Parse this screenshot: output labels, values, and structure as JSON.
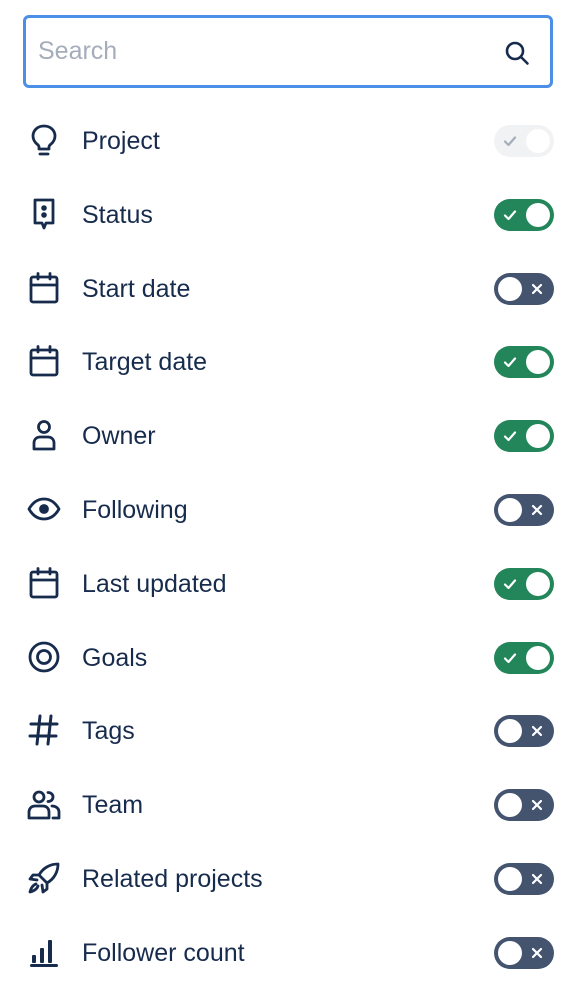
{
  "search": {
    "placeholder": "Search",
    "value": "",
    "icon": "search-icon"
  },
  "colors": {
    "toggle_on": "#22865a",
    "toggle_off": "#44546f",
    "toggle_disabled": "#f1f2f4",
    "focus_border": "#4c8fe6",
    "text": "#172b4d"
  },
  "items": [
    {
      "label": "Project",
      "icon": "lightbulb-icon",
      "state": "on-disabled"
    },
    {
      "label": "Status",
      "icon": "status-icon",
      "state": "on"
    },
    {
      "label": "Start date",
      "icon": "calendar-icon",
      "state": "off"
    },
    {
      "label": "Target date",
      "icon": "calendar-icon",
      "state": "on"
    },
    {
      "label": "Owner",
      "icon": "person-icon",
      "state": "on"
    },
    {
      "label": "Following",
      "icon": "eye-icon",
      "state": "off"
    },
    {
      "label": "Last updated",
      "icon": "calendar-icon",
      "state": "on"
    },
    {
      "label": "Goals",
      "icon": "target-icon",
      "state": "on"
    },
    {
      "label": "Tags",
      "icon": "hashtag-icon",
      "state": "off"
    },
    {
      "label": "Team",
      "icon": "people-icon",
      "state": "off"
    },
    {
      "label": "Related projects",
      "icon": "rocket-icon",
      "state": "off"
    },
    {
      "label": "Follower count",
      "icon": "bar-chart-icon",
      "state": "off"
    }
  ]
}
